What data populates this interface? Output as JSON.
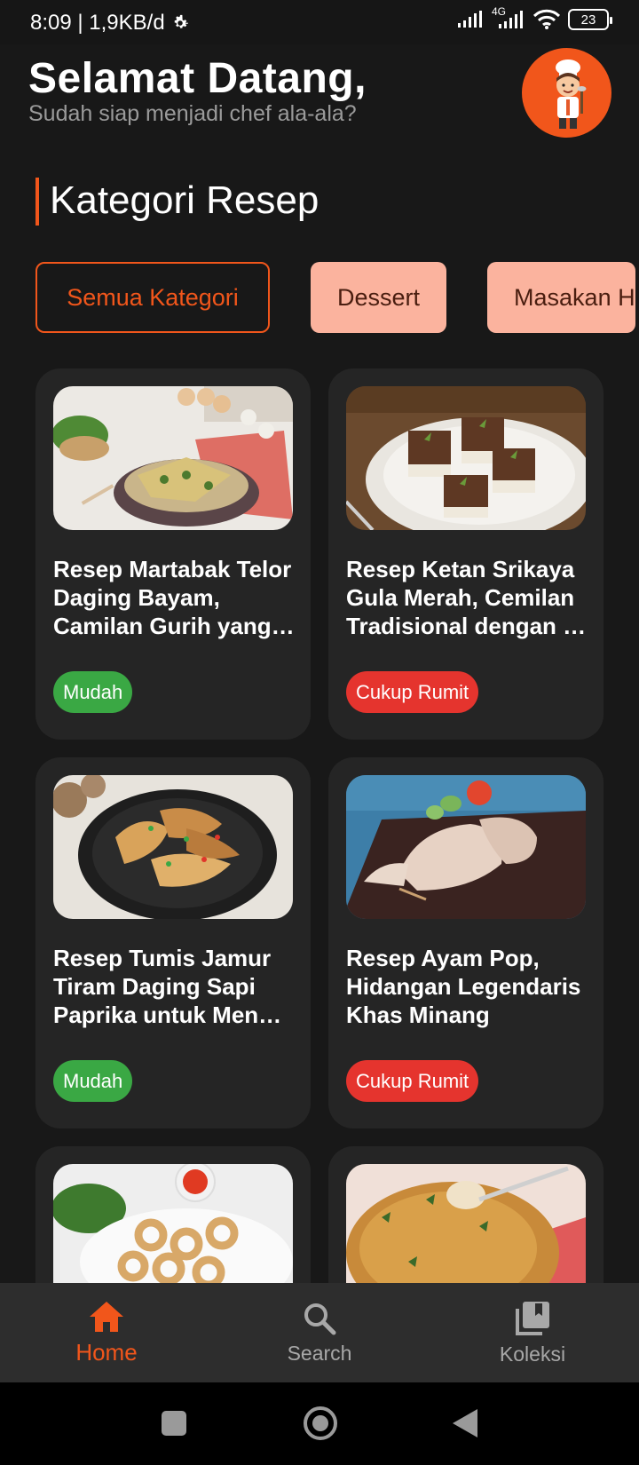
{
  "status": {
    "time_info": "8:09 | 1,9KB/d",
    "network": "4G",
    "battery": "23"
  },
  "header": {
    "greeting": "Selamat Datang,",
    "subtitle": "Sudah siap menjadi chef ala-ala?"
  },
  "section_title": "Kategori Resep",
  "categories": [
    {
      "label": "Semua Kategori",
      "active": true
    },
    {
      "label": "Dessert",
      "active": false
    },
    {
      "label": "Masakan H",
      "active": false
    }
  ],
  "recipes": [
    {
      "title": "Resep Martabak Telor Daging Bayam, Camilan Gurih yang…",
      "difficulty": "Mudah"
    },
    {
      "title": "Resep Ketan Srikaya Gula Merah, Cemilan Tradisional dengan …",
      "difficulty": "Cukup Rumit"
    },
    {
      "title": "Resep Tumis Jamur Tiram Daging Sapi Paprika untuk Men…",
      "difficulty": "Mudah"
    },
    {
      "title": "Resep Ayam Pop, Hidangan Legendaris Khas Minang",
      "difficulty": "Cukup Rumit"
    }
  ],
  "nav": {
    "home": "Home",
    "search": "Search",
    "collection": "Koleksi"
  },
  "colors": {
    "accent": "#f1561b",
    "easy": "#3aa844",
    "hard": "#e5342e",
    "chip_bg": "#fbb39e"
  }
}
